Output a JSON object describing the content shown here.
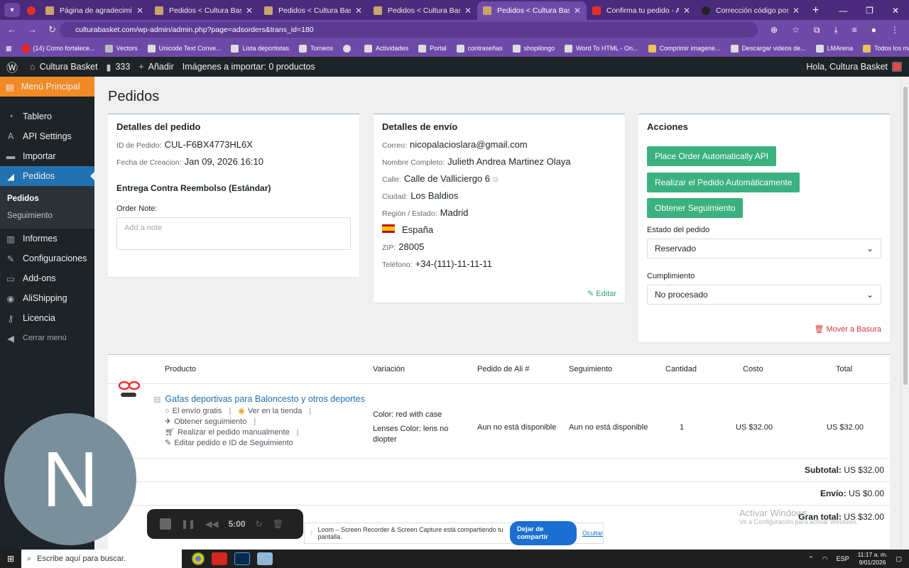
{
  "browser": {
    "tabs": [
      {
        "title": "",
        "icon": "record-icon",
        "small": true
      },
      {
        "title": "Página de agradecimiento",
        "icon": "site-icon"
      },
      {
        "title": "Pedidos < Cultura Basket — W",
        "icon": "site-icon"
      },
      {
        "title": "Pedidos < Cultura Basket — W",
        "icon": "site-icon"
      },
      {
        "title": "Pedidos < Cultura Basket — W",
        "icon": "site-icon"
      },
      {
        "title": "Pedidos < Cultura Basket — W",
        "icon": "site-icon",
        "active": true
      },
      {
        "title": "Confirma tu pedido - AliExpre",
        "icon": "aliexpress-icon"
      },
      {
        "title": "Corrección código postal",
        "icon": "openai-icon"
      }
    ],
    "url": "culturabasket.com/wp-admin/admin.php?page=adsorders&trans_id=180",
    "bookmarks": [
      "(14) Como fortalece...",
      "Vectors",
      "Unicode Text Conve...",
      "Lista deportistas",
      "Torneos",
      "",
      "Actividades",
      "Portal",
      "contraseñas",
      "shopilongo",
      "Word To HTML - On...",
      "Comprimir imagene...",
      "Descargar videos de...",
      "LMArena"
    ],
    "all_bookmarks": "Todos los marcadores"
  },
  "wpbar": {
    "site": "Cultura Basket",
    "comments": "333",
    "add": "Añadir",
    "import_status": "Imágenes a importar: 0 productos",
    "greeting": "Hola, Cultura Basket"
  },
  "sidebar": {
    "main_menu": "Menú Principal",
    "items": [
      "Tablero",
      "API Settings",
      "Importar",
      "Pedidos",
      "Informes",
      "Configuraciones",
      "Add-ons",
      "AliShipping",
      "Licencia",
      "Cerrar menú"
    ],
    "sub": [
      "Pedidos",
      "Seguimiento"
    ]
  },
  "page": {
    "title": "Pedidos"
  },
  "order": {
    "heading": "Detalles del pedido",
    "id_label": "ID de Pedido:",
    "id": "CUL-F6BX4773HL6X",
    "date_label": "Fecha de Creacion:",
    "date": "Jan 09, 2026 16:10",
    "delivery": "Entrega Contra Reembolso (Estándar)",
    "note_label": "Order Note:",
    "note_placeholder": "Add a note"
  },
  "shipping": {
    "heading": "Detalles de envío",
    "email_label": "Correo:",
    "email": "nicopalacioslara@gmail.com",
    "name_label": "Nombre Completo:",
    "name": "Julieth Andrea Martinez Olaya",
    "street_label": "Calle:",
    "street": "Calle de Valliciergo 6",
    "city_label": "Ciudad:",
    "city": "Los Baldios",
    "region_label": "Región / Estado:",
    "region": "Madrid",
    "country": "España",
    "zip_label": "ZIP:",
    "zip": "28005",
    "phone_label": "Teléfono:",
    "phone": "+34-(111)-11-11-11",
    "edit": "Editar"
  },
  "actions": {
    "heading": "Acciones",
    "btn_api": "Place Order Automatically API",
    "btn_auto": "Realizar el Pedido Automáticamente",
    "btn_track": "Obtener Seguimiento",
    "status_label": "Estado del pedido",
    "status": "Reservado",
    "fulfil_label": "Cumplimiento",
    "fulfil": "No procesado",
    "trash": "Mover a Basura"
  },
  "table": {
    "headers": [
      "Producto",
      "Variación",
      "Pedido de Ali #",
      "Seguimiento",
      "Cantidad",
      "Costo",
      "Total"
    ],
    "row": {
      "product": "Gafas deportivas para Baloncesto y otros deportes",
      "free_shipping": "El envío gratis",
      "view_store": "Ver en la tienda",
      "get_tracking": "Obtener seguimiento",
      "manual_order": "Realizar el pedido manualmente",
      "edit_order": "Editar pedido e ID de Seguimiento",
      "variation_color": "Color: red with case",
      "variation_lens": "Lenses Color: lens no diopter",
      "ali_order": "Aun no está disponible",
      "tracking": "Aun no está disponible",
      "quantity": "1",
      "cost": "US $32.00",
      "total": "US $32.00"
    },
    "subtotal_label": "Subtotal:",
    "subtotal": "US $32.00",
    "shipping_label": "Envío:",
    "shipping": "US $0.00",
    "grand_label": "Gran total:",
    "grand": "US $32.00"
  },
  "overlays": {
    "avatar_letter": "N",
    "timer": "5:00",
    "loom_msg": "Loom – Screen Recorder & Screen Capture está compartiendo tu pantalla.",
    "loom_stop": "Dejar de compartir",
    "loom_hide": "Ocultar",
    "watermark": "Activar Windows",
    "watermark_sub": "Ve a Configuración para activar Windows."
  },
  "taskbar": {
    "search": "Escribe aquí para buscar.",
    "lang": "ESP",
    "time": "11:17 a. m.",
    "date": "9/01/2026"
  }
}
